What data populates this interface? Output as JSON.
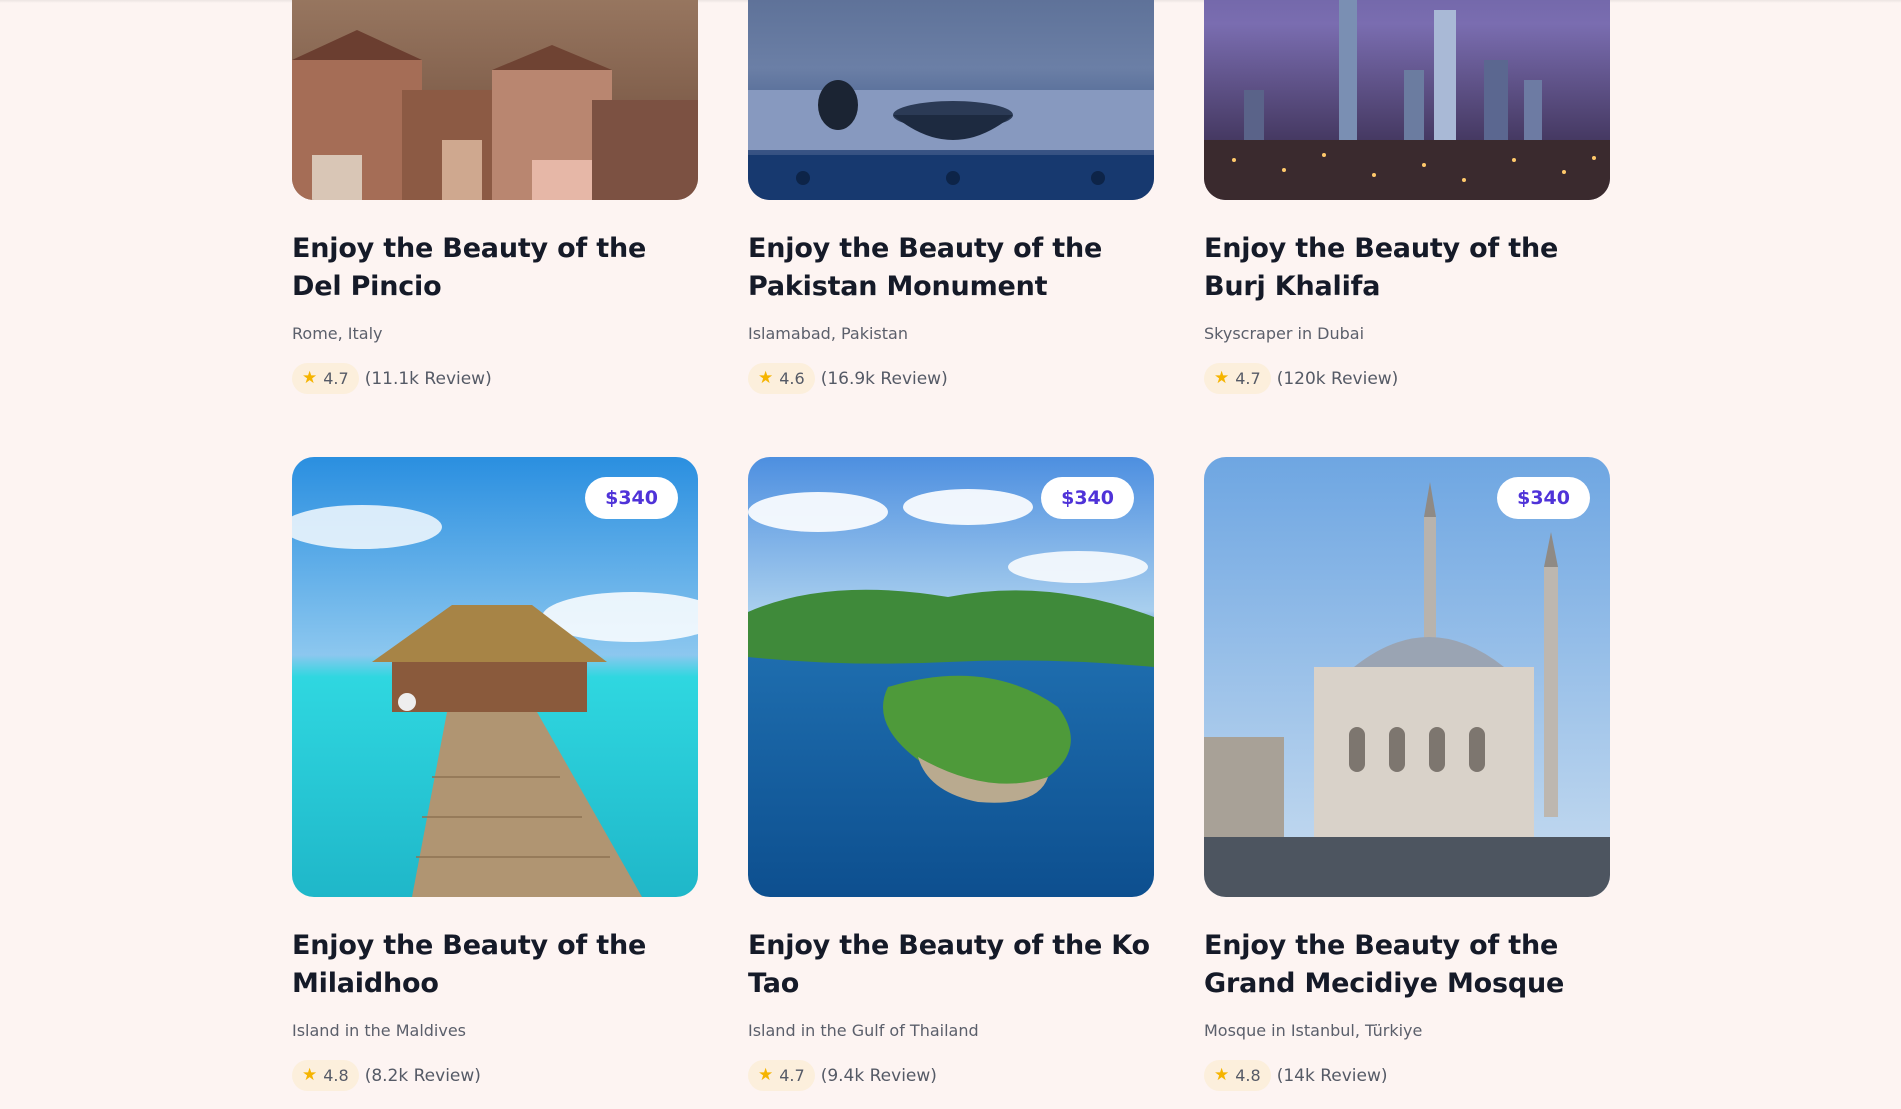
{
  "cards": [
    {
      "title": "Enjoy the Beauty of the Del Pincio",
      "subtitle": "Rome, Italy",
      "rating": "4.7",
      "reviews": "(11.1k Review)",
      "image_icon": "rome-rooftops-photo"
    },
    {
      "title": "Enjoy the Beauty of the Pakistan Monument",
      "subtitle": "Islamabad, Pakistan",
      "rating": "4.6",
      "reviews": "(16.9k Review)",
      "image_icon": "pakistan-monument-photo"
    },
    {
      "title": "Enjoy the Beauty of the Burj Khalifa",
      "subtitle": "Skyscraper in Dubai",
      "rating": "4.7",
      "reviews": "(120k Review)",
      "image_icon": "dubai-skyline-photo"
    },
    {
      "price": "$340",
      "title": "Enjoy the Beauty of the Milaidhoo",
      "subtitle": "Island in the Maldives",
      "rating": "4.8",
      "reviews": "(8.2k Review)",
      "image_icon": "maldives-water-villa-photo"
    },
    {
      "price": "$340",
      "title": "Enjoy the Beauty of the Ko Tao",
      "subtitle": "Island in the Gulf of Thailand",
      "rating": "4.7",
      "reviews": "(9.4k Review)",
      "image_icon": "ko-tao-island-photo"
    },
    {
      "price": "$340",
      "title": "Enjoy the Beauty of the Grand Mecidiye Mosque",
      "subtitle": "Mosque in Istanbul, Türkiye",
      "rating": "4.8",
      "reviews": "(14k Review)",
      "image_icon": "mecidiye-mosque-photo"
    }
  ],
  "colors": {
    "background": "#fdf4f2",
    "price_text": "#4f33d8",
    "rating_pill": "#fcefdc",
    "star": "#f5b400"
  }
}
